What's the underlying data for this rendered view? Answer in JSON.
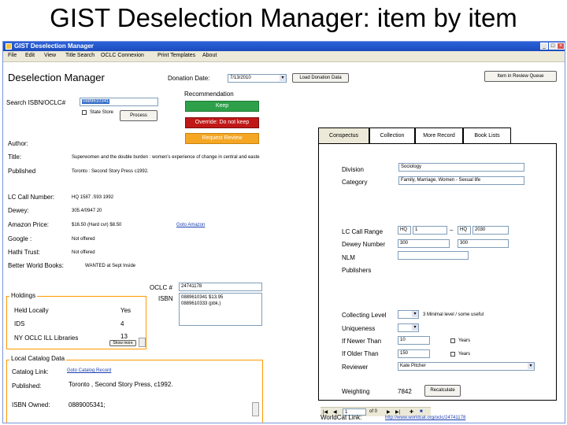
{
  "slide_title": "GIST Deselection Manager: item by item",
  "window": {
    "title": "GIST Deselection Manager"
  },
  "menu": [
    "File",
    "Edit",
    "View",
    "Title Search",
    "OCLC Connexion",
    "Print Templates",
    "About"
  ],
  "header": {
    "app_title": "Deselection Manager",
    "donation_date_label": "Donation Date:",
    "donation_date_value": "7/13/2010",
    "load_donation_btn": "Load Donation Data",
    "review_queue_btn": "Item in Review Queue"
  },
  "search": {
    "label": "Search ISBN/OCLC#",
    "value": "0889610341",
    "state_store_label": "State Store",
    "process_btn": "Process"
  },
  "recommendation": {
    "label": "Recommendation",
    "keep": "Keep",
    "override": "Override:  Do not keep",
    "request_review": "Request Review",
    "keep_color": "#2ea04a",
    "override_color": "#c01818",
    "review_color": "#f5a623"
  },
  "item": {
    "author_label": "Author:",
    "title_label": "Title:",
    "title_value": "Superwomen and the double burden : women's experience of change in central and easte",
    "published_label": "Published",
    "published_value": "Toronto : Second Story Press c1992.",
    "lc_call_label": "LC Call Number:",
    "lc_call_value": "HQ 1587 .S93 1992",
    "dewey_label": "Dewey:",
    "dewey_value": "305.4/0947 20",
    "amazon_label": "Amazon Price:",
    "amazon_value": "$16.50 (Hard cvr) $8.50",
    "goto_amazon": "Goto Amazon",
    "google_label": "Google :",
    "google_value": "Not offered",
    "hathi_label": "Hathi Trust:",
    "hathi_value": "Not offered",
    "bwb_label": "Better World Books:",
    "bwb_value": "WANTED at Sept Inside"
  },
  "oclc": {
    "oclc_label": "OCLC #",
    "oclc_value": "24741178",
    "isbn_label": "ISBN",
    "isbn_values": [
      "0889610341  $13.95",
      "0889610333  (pbk.)"
    ]
  },
  "holdings": {
    "legend": "Holdings",
    "rows": [
      {
        "label": "Held Locally",
        "value": "Yes"
      },
      {
        "label": "IDS",
        "value": "4"
      },
      {
        "label": "NY OCLC ILL Libraries",
        "value": "13"
      }
    ],
    "more_btn": "Show more"
  },
  "local_catalog": {
    "legend": "Local Catalog Data",
    "link_label": "Catalog Link:",
    "link_value": "Goto Catalog Record",
    "published_label": "Published:",
    "published_value": "Toronto , Second Story Press,    c1992.",
    "isbn_owned_label": "ISBN Owned:",
    "isbn_owned_value": "0889005341;"
  },
  "tabs": [
    "Conspectus",
    "Collection",
    "More Record",
    "Book Lists"
  ],
  "conspectus": {
    "division_label": "Division",
    "division_value": "Sociology",
    "category_label": "Category",
    "category_value": "Family, Marriage, Women - Sexual life",
    "lc_call_range_label": "LC Call Range",
    "lc_from_prefix": "HQ",
    "lc_from_num": "1",
    "lc_to_prefix": "HQ",
    "lc_to_num": "2030",
    "dewey_number_label": "Dewey Number",
    "dewey_from": "300",
    "dewey_to": "300",
    "nlm_label": "NLM",
    "publishers_label": "Publishers",
    "collecting_level_label": "Collecting Level",
    "collecting_level_note": "3 Minimal level / some useful",
    "uniqueness_label": "Uniqueness",
    "if_newer_label": "If Newer Than",
    "if_newer_value": "10",
    "if_older_label": "If Older Than",
    "if_older_value": "150",
    "year_label": "Years",
    "reviewer_label": "Reviewer",
    "reviewer_value": "Kate Pitcher",
    "weighting_label": "Weighting",
    "weighting_value": "7842",
    "recalculate_btn": "Recalculate",
    "nav_record": "1",
    "nav_of": "of 0"
  },
  "worldcat": {
    "label": "WorldCat Link:",
    "value": "http://www.worldcat.org/oclc/24741178"
  }
}
